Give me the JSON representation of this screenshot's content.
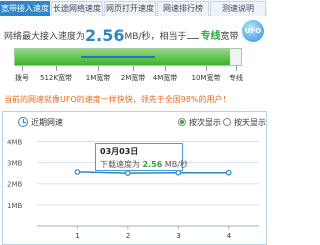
{
  "tabs": [
    "宽带接入速度",
    "长途网络速度",
    "网页打开速度",
    "网速排行榜",
    "测速说明"
  ],
  "speed": {
    "prefix": "网络最大接入速度为",
    "value": "2.56",
    "unit": "MB/秒，相当于",
    "equiv": "专线",
    "suffix": "宽带",
    "badge": "UFO"
  },
  "scale": {
    "labels": [
      "拨号",
      "512K宽带",
      "1M宽带",
      "2M宽带",
      "4M宽带",
      "10M宽带",
      "专线"
    ],
    "fill_fraction": 0.95,
    "marker_from": 0.29,
    "marker_to": 0.62
  },
  "note": "当前的网速就像UFO的速度一样快快，领先于全国98%的用户！",
  "history": {
    "title": "近期网速",
    "options": [
      "按次显示",
      "按天显示"
    ],
    "selected": 0,
    "tooltip": {
      "date": "03月03日",
      "label": "下载速度为",
      "value": "2.56",
      "unit": "MB/秒"
    }
  },
  "chart_data": {
    "type": "line",
    "x": [
      1,
      2,
      3,
      4
    ],
    "y_unit": "MB",
    "yticks": [
      "4MB",
      "3MB",
      "2MB",
      "1MB"
    ],
    "ylim": [
      0,
      4.4
    ],
    "xlim": [
      0.2,
      4.6
    ],
    "series": [
      {
        "values": [
          2.56,
          2.5,
          2.52,
          2.52
        ]
      }
    ],
    "colors": {
      "line": "#2f86c6",
      "grid": "#d7e3ec"
    }
  }
}
